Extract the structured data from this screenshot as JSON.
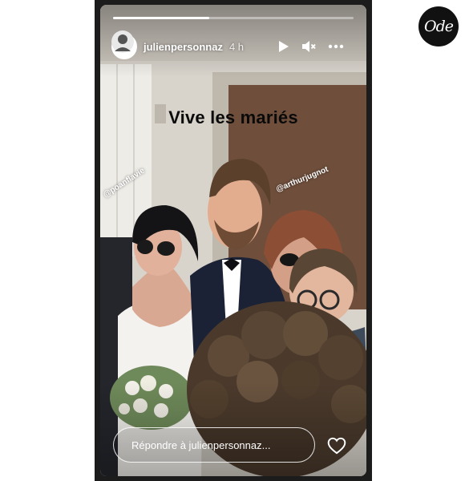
{
  "brand_badge": "Ode",
  "story": {
    "progress_fraction": 0.4,
    "username": "julienpersonnaz",
    "time": "4 h",
    "caption": "Vive les mariés",
    "mentions": [
      "@poanflavie",
      "@arthurjugnot"
    ],
    "reply_placeholder": "Répondre à julienpersonnaz...",
    "controls": [
      "play-icon",
      "mute-icon",
      "more-icon"
    ]
  }
}
